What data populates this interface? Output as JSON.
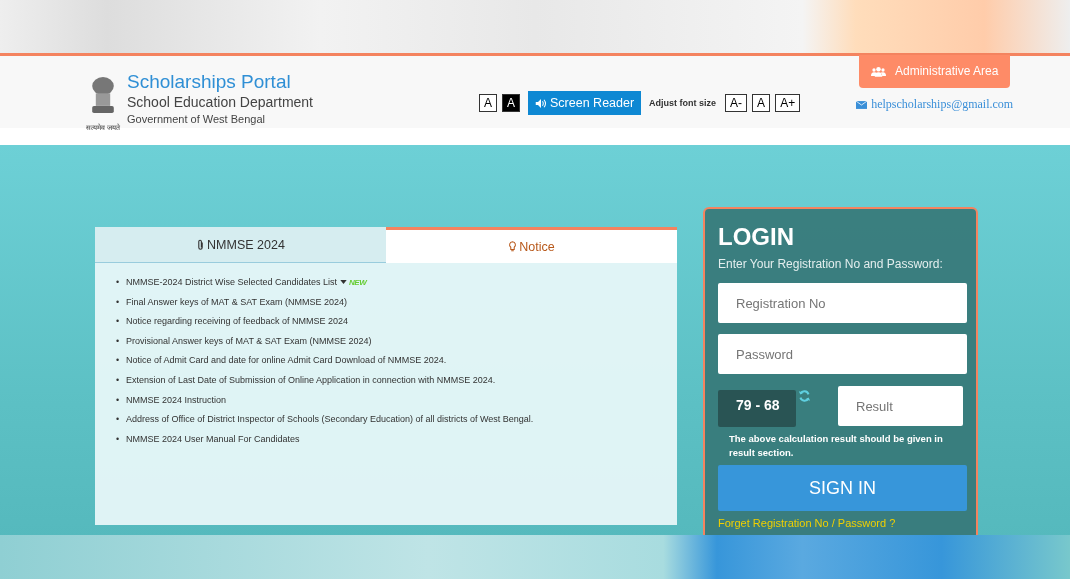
{
  "header": {
    "emblem_motto": "सत्यमेव जयते",
    "title": "Scholarships Portal",
    "subtitle": "School Education Department",
    "government": "Government of West Bengal",
    "contrast_buttons": [
      {
        "label": "A",
        "kind": "light"
      },
      {
        "label": "A",
        "kind": "dark"
      }
    ],
    "screen_reader": "Screen Reader",
    "font_size_label": "Adjust font size",
    "font_buttons": [
      "A-",
      "A",
      "A+"
    ],
    "admin_button": "Administrative Area",
    "email": "helpscholarships@gmail.com"
  },
  "tabs": [
    {
      "label": "NMMSE 2024",
      "selected": false
    },
    {
      "label": "Notice",
      "selected": true
    }
  ],
  "notices": [
    {
      "bullet": "•",
      "text": "NMMSE-2024 District Wise Selected Candidates List",
      "badge": "NEW"
    },
    {
      "bullet": "•",
      "text": "Final Answer keys of MAT & SAT Exam (NMMSE 2024)"
    },
    {
      "bullet": "•",
      "text": "Notice regarding receiving of feedback of NMMSE 2024"
    },
    {
      "bullet": "•",
      "text": "Provisional Answer keys of MAT & SAT Exam (NMMSE 2024)"
    },
    {
      "bullet": "•",
      "text": "Notice of Admit Card and date for online Admit Card Download of NMMSE 2024."
    },
    {
      "bullet": "•",
      "text": "Extension of Last Date of Submission of Online Application in connection with NMMSE 2024."
    },
    {
      "bullet": "•",
      "text": "NMMSE 2024 Instruction"
    },
    {
      "bullet": "•",
      "text": "Address of Office of District Inspector of Schools (Secondary Education) of all districts of West Bengal."
    },
    {
      "bullet": "•",
      "text": "NMMSE 2024 User Manual For Candidates"
    }
  ],
  "login": {
    "title": "LOGIN",
    "instruction": "Enter Your Registration No and Password:",
    "registration_placeholder": "Registration No",
    "password_placeholder": "Password",
    "captcha": "79 - 68",
    "result_placeholder": "Result",
    "captcha_hint": "The above calculation result should be given in result section.",
    "sign_in": "SIGN IN",
    "forgot_link": "Forget Registration No / Password ?"
  }
}
